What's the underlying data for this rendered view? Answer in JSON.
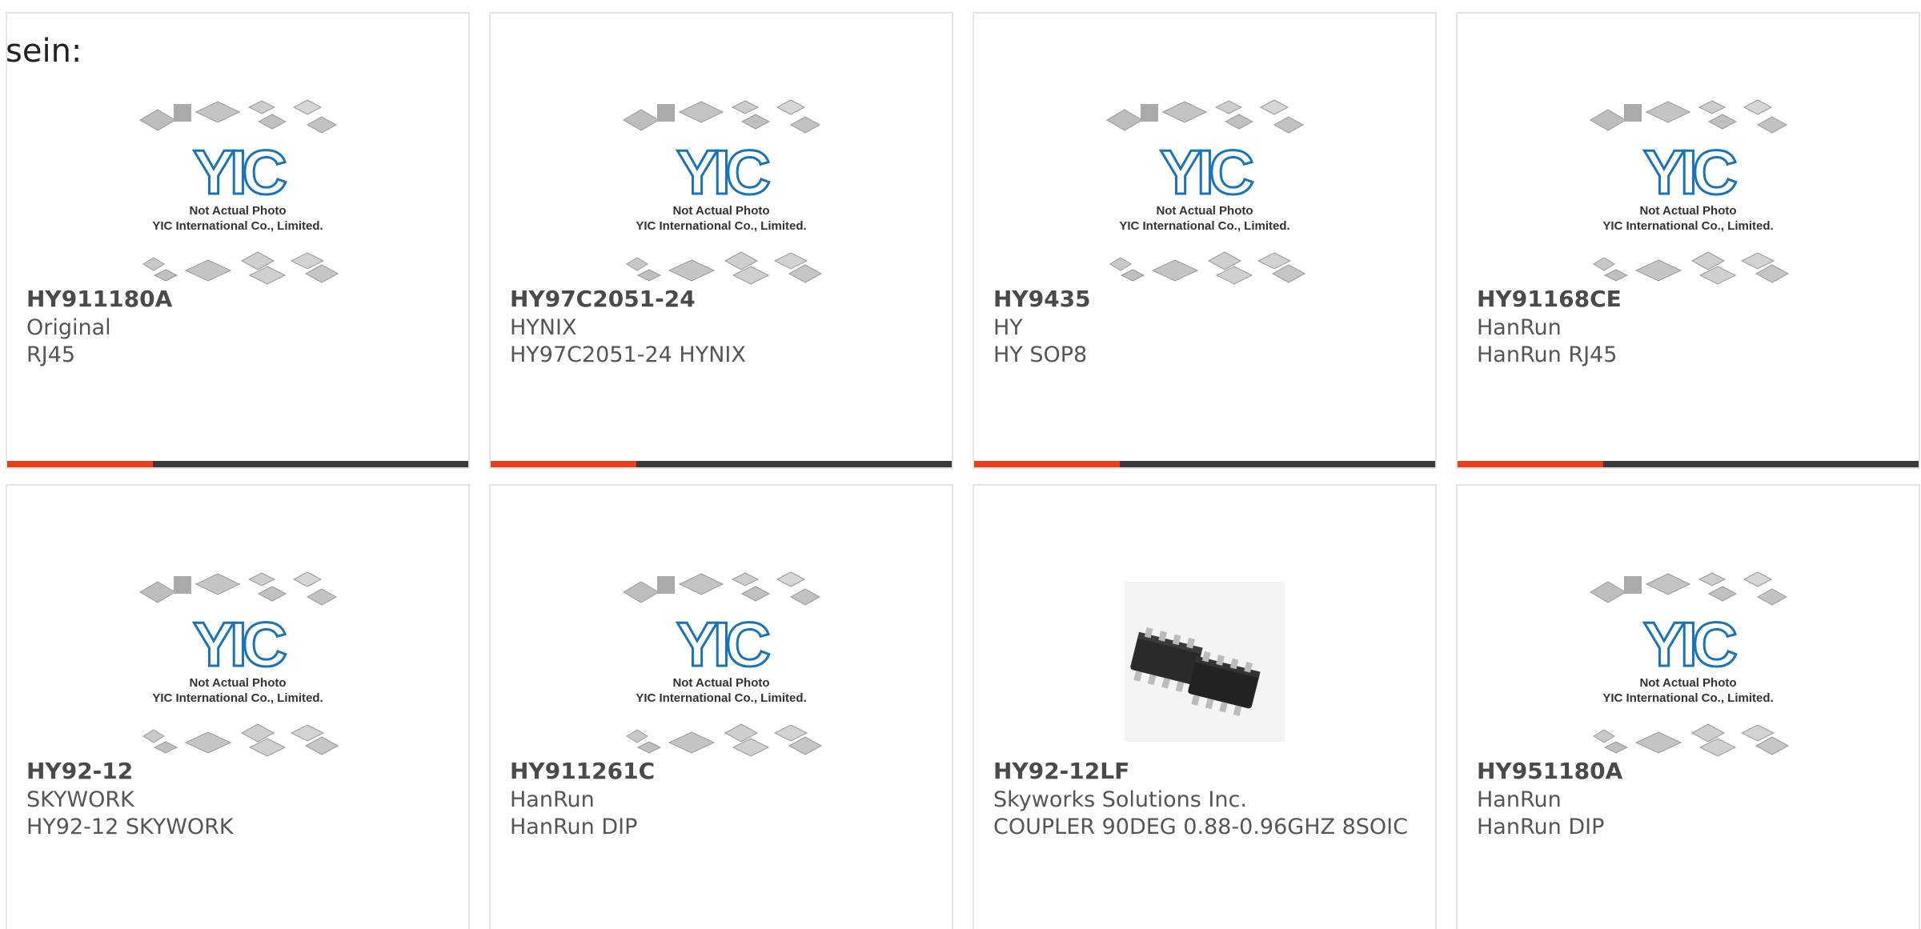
{
  "intro_text": "sein:",
  "placeholder": {
    "line1": "Not Actual Photo",
    "line2": "YIC International Co., Limited.",
    "logo_text": "YIC",
    "logo_color": "#1a73b8"
  },
  "colors": {
    "accent": "#e8401c",
    "bar": "#3a3a3a",
    "border": "#e4e4e4"
  },
  "products": [
    {
      "part": "HY911180A",
      "manufacturer": "Original",
      "description": "RJ45",
      "image": "placeholder"
    },
    {
      "part": "HY97C2051-24",
      "manufacturer": "HYNIX",
      "description": "HY97C2051-24 HYNIX",
      "image": "placeholder"
    },
    {
      "part": "HY9435",
      "manufacturer": "HY",
      "description": "HY SOP8",
      "image": "placeholder"
    },
    {
      "part": "HY91168CE",
      "manufacturer": "HanRun",
      "description": "HanRun RJ45",
      "image": "placeholder"
    },
    {
      "part": "HY92-12",
      "manufacturer": "SKYWORK",
      "description": "HY92-12 SKYWORK",
      "image": "placeholder"
    },
    {
      "part": "HY911261C",
      "manufacturer": "HanRun",
      "description": "HanRun DIP",
      "image": "placeholder"
    },
    {
      "part": "HY92-12LF",
      "manufacturer": "Skyworks Solutions Inc.",
      "description": "COUPLER 90DEG 0.88-0.96GHZ 8SOIC",
      "image": "soic-chip-photo"
    },
    {
      "part": "HY951180A",
      "manufacturer": "HanRun",
      "description": "HanRun DIP",
      "image": "placeholder"
    }
  ]
}
